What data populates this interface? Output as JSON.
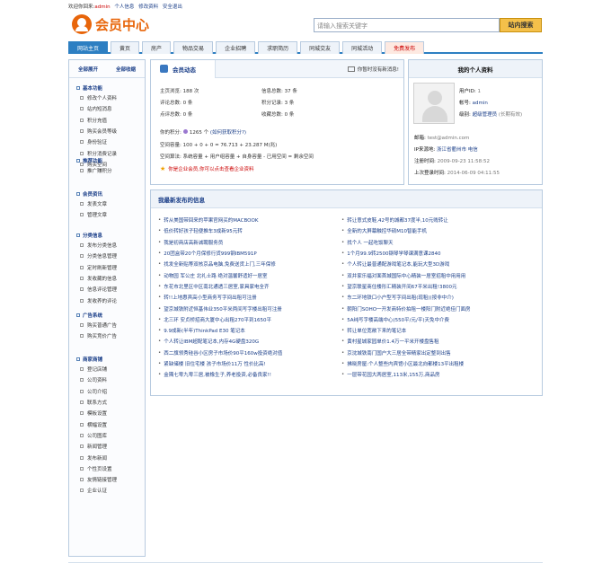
{
  "topbar": {
    "welcome": "欢迎你回来:",
    "username": "admin",
    "links": [
      "个人信息",
      "修改资料",
      "安全退出"
    ]
  },
  "logo": {
    "title": "会员中心"
  },
  "search": {
    "placeholder": "请输入搜索关键字",
    "button": "站内搜索"
  },
  "nav": {
    "tabs": [
      "网站主页",
      "黄页",
      "房产",
      "物品交易",
      "企业招聘",
      "求职简历",
      "同城交友",
      "同城活动",
      "免费发布"
    ],
    "active": 0
  },
  "sidebar": {
    "expand_all": "全部展开",
    "collapse_all": "全部收缩",
    "groups": [
      {
        "title": "基本功能",
        "items": [
          "修改个人资料",
          "站内短消息",
          "积分充值",
          "购买会员等级",
          "身份验证",
          "积分消费记录",
          "购买空间"
        ]
      },
      {
        "title": "推荐功能",
        "items": [
          "推广赚积分"
        ]
      },
      {
        "title": "会员资讯",
        "items": [
          "发表文章",
          "管理文章"
        ]
      },
      {
        "title": "分类信息",
        "items": [
          "发布分类信息",
          "分类信息管理",
          "定时刷新管理",
          "发收藏的信息",
          "信息评论管理",
          "发收养的评论"
        ]
      },
      {
        "title": "广告系统",
        "items": [
          "购买普通广告",
          "购买竞价广告"
        ]
      },
      {
        "title": "商家商铺",
        "items": [
          "登记店铺",
          "公司资料",
          "公司介绍",
          "联系方式",
          "模板设置",
          "横幅设置",
          "公司图库",
          "新闻管理",
          "发布新闻",
          "个性页设置",
          "友情链接管理",
          "企业认证"
        ]
      }
    ]
  },
  "dynamics": {
    "tab": "会员动态",
    "tip": "你暂时没有新消息!",
    "stats": [
      [
        {
          "k": "主页浏览:",
          "v": "188 次"
        },
        {
          "k": "信息总数:",
          "v": "37 条"
        }
      ],
      [
        {
          "k": "评论总数:",
          "v": "0 条"
        },
        {
          "k": "积分记录:",
          "v": "3 条"
        }
      ],
      [
        {
          "k": "点评总数:",
          "v": "0 条"
        },
        {
          "k": "收藏总数:",
          "v": "0 条"
        }
      ]
    ],
    "points_label": "你的积分:",
    "points_value": "1265 个",
    "points_link": "(如何获取积分?)",
    "space_label": "空间容量:",
    "space_value": "100 + 0 + 0 = 76.713 + 23.287 M(兆)",
    "algo_label": "空间算法:",
    "algo_value": "系统容量 + 用户组容量 + 自身容量 - 已用空间 = 剩余空间",
    "warning": "你是企业会员,你可以点击查看企业资料"
  },
  "profile": {
    "title": "我的个人资料",
    "uid_label": "用户ID:",
    "uid": "1",
    "account_label": "帐号:",
    "account": "admin",
    "level_label": "级别:",
    "level": "超级管理员",
    "level_note": "(长期有效)",
    "email_label": "邮箱:",
    "email": "test@admin.com",
    "ip_label": "IP来源地:",
    "ip": "浙江省衢州市 电信",
    "reg_label": "注册时间:",
    "reg": "2009-09-23 11:58:52",
    "last_label": "上次登录时间:",
    "last": "2014-06-09 04:11:55"
  },
  "news": {
    "title": "我最新发布的信息",
    "left": [
      "转从美国带回来的苹果官网买的MACBOOK",
      "低价转好孩子轻便推车3成新95元转",
      "我是初商店高新诚聘服务员",
      "20团盒带20个月保修行货999钢IBM591P",
      "找发全新贴等双核京品电脑,免费送货上门,三年保修",
      "动物园 军公庄 北礼士路 绝对温馨舒适好一居室",
      "东花市北里区中区南北通透三居室,家具家电全齐",
      "转!!上地惠宾高小型商务写字间出租可注册",
      "望京城铁附近恒基伟业350平米两间写字楼出租可注册",
      "北三环 安贞桥招商大厦中心出租270平到1650平",
      "9.9成新(半年)ThinkPad E30 笔记本",
      "个人转让IBM超配笔记本,内存4G硬盘320G",
      "西二旗领秀硅谷小区房子市场价90平160w投资绝对值",
      "紧缺储楼 旧住宅楼 孩子市场价11万 性价比高!",
      "金隅七零九零三居,被橡生子,养老投资,必备良家!!"
    ],
    "right": [
      "转让意式皮鞋,42号的城都37度半,10元贱转让",
      "全新的大屏幕触控华硕M10智能手机",
      "找个人 一起吃饭聊天",
      "1个月99.9转2500钢琴学琴课满意课2840",
      "个人转让最普通配游戏笔记本,能玩大型3D游戏",
      "双井家乐福对面首城国际中心精装一居室招租中用用用",
      "望京联星商住楼形汇精装开间67平米出租!3800元",
      "东二环地铁口小户型写字间出租(现租)(按非中介)",
      "朝阳门SOHO一开发商特价拍租一楼阳门附近绝佳门面房",
      "5A纯写字楼高端中心(550平/元/平)天免中介费",
      "转让单位宽敞下来的笔记本",
      "黄村星城家园单价1.4万一平米开楼盘售租",
      "京沈城铁南门国户大三居全带精家出定整到出售",
      "拂晓房屋:个人整些内宾馆小区最北向都楼13平出租楼",
      "一层带花园大两居室,113米,155万,商品房"
    ]
  }
}
